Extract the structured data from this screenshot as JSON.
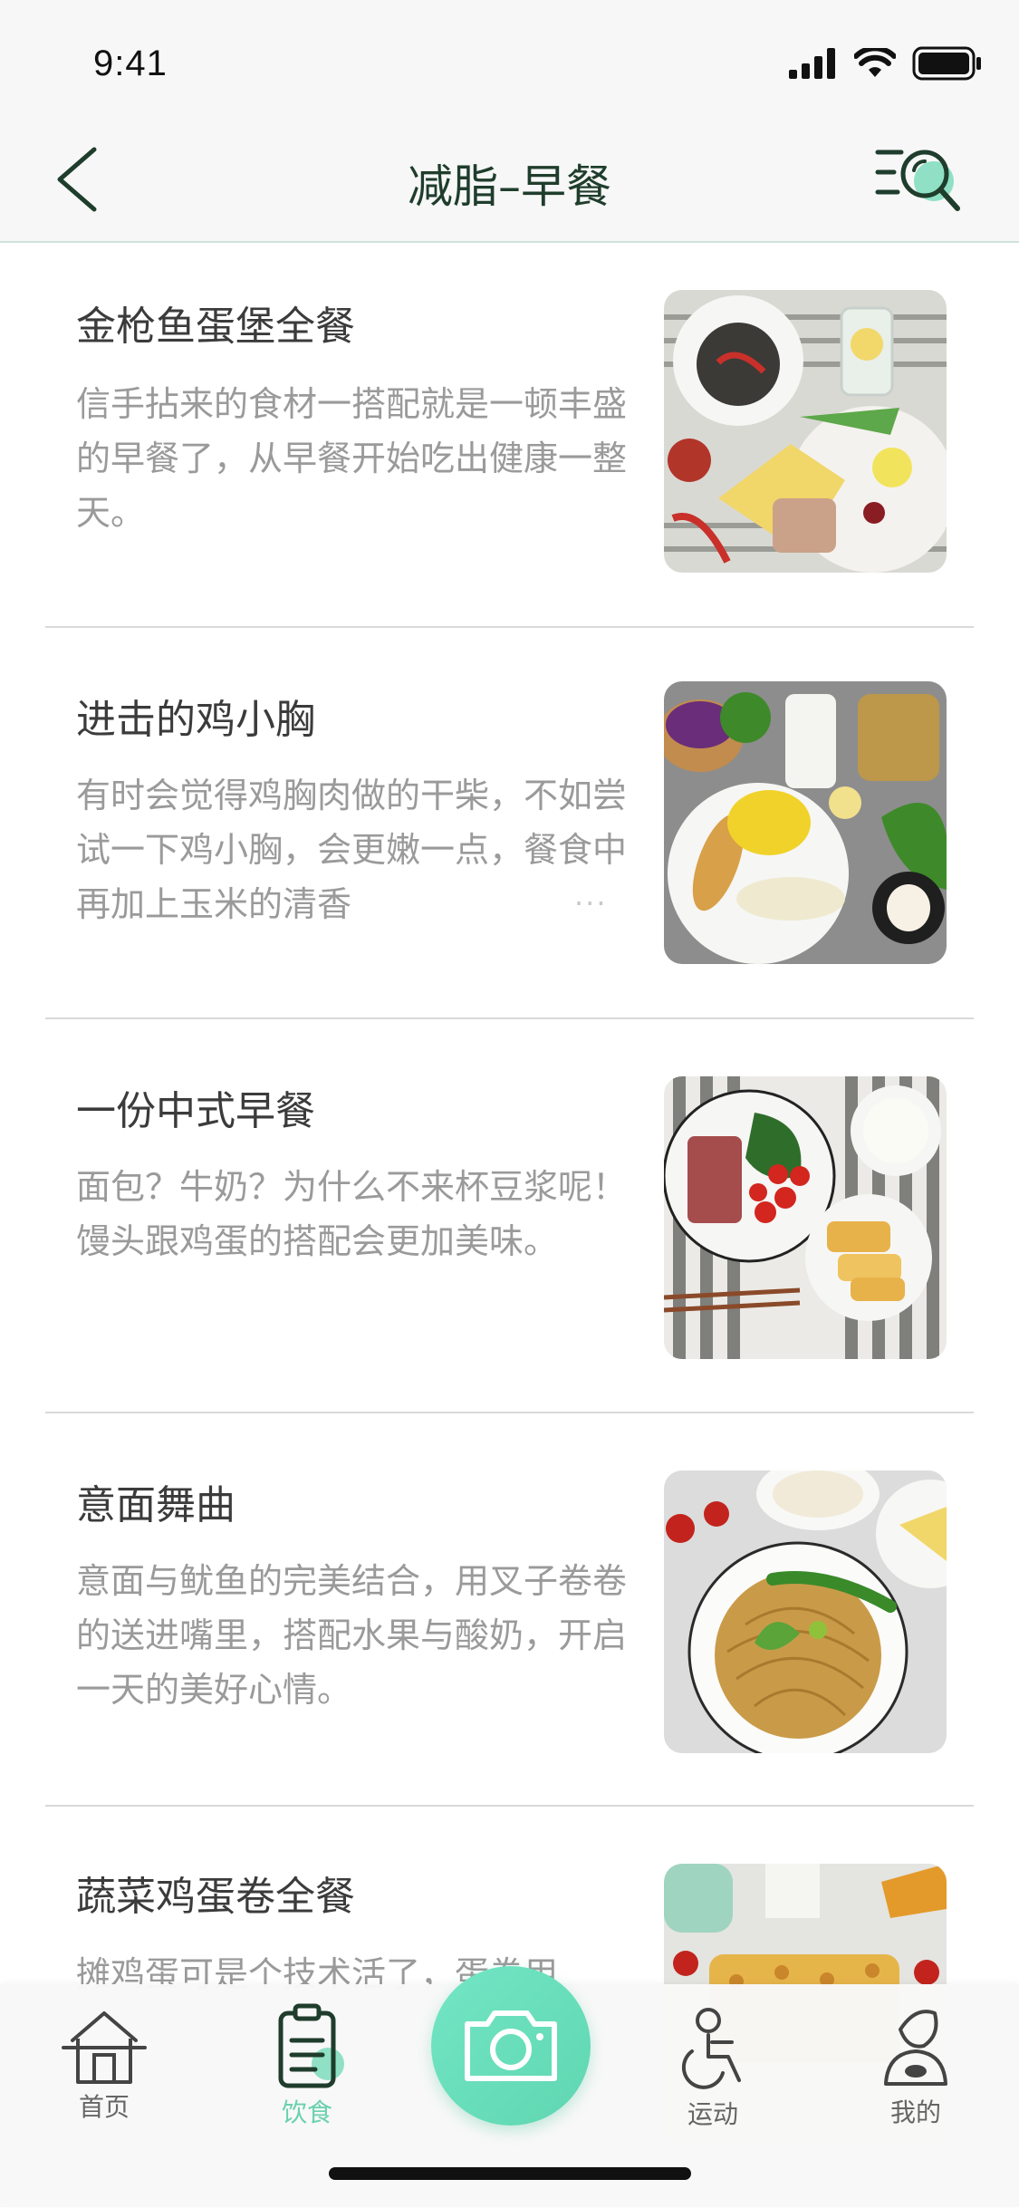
{
  "status_bar": {
    "time": "9:41"
  },
  "nav": {
    "title": "减脂–早餐"
  },
  "items": [
    {
      "title": "金枪鱼蛋堡全餐",
      "desc": "信手拈来的食材一搭配就是一顿丰盛的早餐了，从早餐开始吃出健康一整天。"
    },
    {
      "title": "进击的鸡小胸",
      "desc": "有时会觉得鸡胸肉做的干柴，不如尝试一下鸡小胸，会更嫩一点，餐食中再加上玉米的清香",
      "more": "···"
    },
    {
      "title": "一份中式早餐",
      "desc": "面包？牛奶？为什么不来杯豆浆呢！馒头跟鸡蛋的搭配会更加美味。"
    },
    {
      "title": "意面舞曲",
      "desc": "意面与鱿鱼的完美结合，用叉子卷卷的送进嘴里，搭配水果与酸奶，开启一天的美好心情。"
    },
    {
      "title": "蔬菜鸡蛋卷全餐",
      "desc": "摊鸡蛋可是个技术活了，蛋卷用"
    }
  ],
  "tabs": [
    {
      "label": "首页",
      "icon": "house-icon"
    },
    {
      "label": "饮食",
      "icon": "clipboard-icon"
    },
    {
      "label": "运动",
      "icon": "running-person-icon"
    },
    {
      "label": "我的",
      "icon": "profile-icon"
    }
  ],
  "colors": {
    "accent": "#6ad1ad",
    "title": "#1f3d2c",
    "desc": "#9a9a9a"
  }
}
